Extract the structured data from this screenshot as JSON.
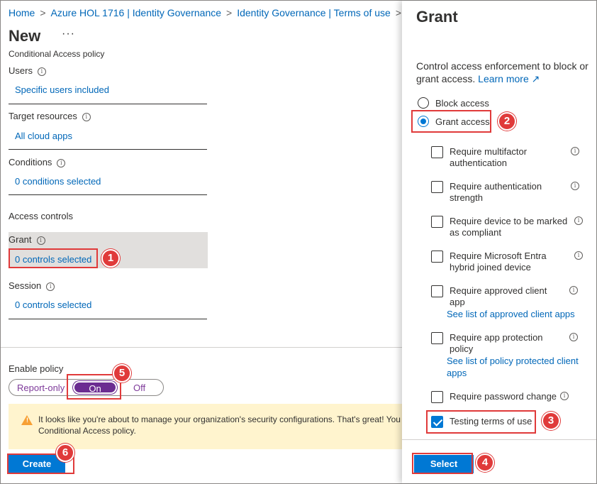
{
  "breadcrumb": {
    "items": [
      "Home",
      "Azure HOL 1716 | Identity Governance",
      "Identity Governance | Terms of use"
    ],
    "separator": ">"
  },
  "page": {
    "title": "New",
    "more_label": "···",
    "subtitle": "Conditional Access policy"
  },
  "sections": {
    "users": {
      "label": "Users",
      "value": "Specific users included"
    },
    "target_resources": {
      "label": "Target resources",
      "value": "All cloud apps"
    },
    "conditions": {
      "label": "Conditions",
      "value": "0 conditions selected"
    },
    "access_controls_heading": "Access controls",
    "grant": {
      "label": "Grant",
      "value": "0 controls selected"
    },
    "session": {
      "label": "Session",
      "value": "0 controls selected"
    }
  },
  "enable_policy": {
    "label": "Enable policy",
    "options": [
      "Report-only",
      "On",
      "Off"
    ],
    "selected": "On"
  },
  "warning": {
    "line1": "It looks like you're about to manage your organization's security configurations. That's great! You",
    "line2": "Conditional Access policy."
  },
  "create_button": "Create",
  "grant_panel": {
    "title": "Grant",
    "description": "Control access enforcement to block or grant access.",
    "learn_more": "Learn more",
    "radios": [
      {
        "label": "Block access",
        "selected": false
      },
      {
        "label": "Grant access",
        "selected": true
      }
    ],
    "checkboxes": [
      {
        "label_lines": [
          "Require multifactor",
          "authentication"
        ],
        "checked": false,
        "link_lines": []
      },
      {
        "label_lines": [
          "Require authentication",
          "strength"
        ],
        "checked": false,
        "link_lines": []
      },
      {
        "label_lines": [
          "Require device to be marked",
          "as compliant"
        ],
        "checked": false,
        "link_lines": []
      },
      {
        "label_lines": [
          "Require Microsoft Entra",
          "hybrid joined device"
        ],
        "checked": false,
        "link_lines": []
      },
      {
        "label_lines": [
          "Require approved client",
          "app"
        ],
        "checked": false,
        "link_lines": [
          "See list of approved client apps"
        ]
      },
      {
        "label_lines": [
          "Require app protection",
          "policy"
        ],
        "checked": false,
        "link_lines": [
          "See list of policy protected client",
          "apps"
        ]
      },
      {
        "label_lines": [
          "Require password change"
        ],
        "checked": false,
        "link_lines": []
      },
      {
        "label_lines": [
          "Testing terms of use"
        ],
        "checked": true,
        "link_lines": []
      }
    ],
    "select_button": "Select"
  },
  "callouts": [
    "1",
    "2",
    "3",
    "4",
    "5",
    "6"
  ],
  "colors": {
    "accent": "#0078d4",
    "link": "#0067b8",
    "toggle_on": "#6b2c91",
    "callout": "#e03a3a",
    "warning_bg": "#fff4ce"
  }
}
